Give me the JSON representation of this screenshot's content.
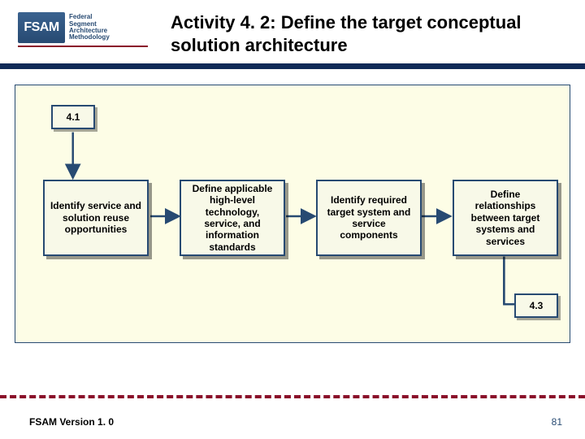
{
  "logo": {
    "mark": "FSAM",
    "line1": "Federal",
    "line2": "Segment",
    "line3": "Architecture",
    "line4": "Methodology"
  },
  "title": "Activity 4. 2:  Define the target conceptual solution architecture",
  "refs": {
    "in": "4.1",
    "out": "4.3"
  },
  "steps": [
    "Identify service and solution reuse opportunities",
    "Define applicable high-level technology, service, and information standards",
    "Identify required target system and service components",
    "Define relationships between target systems and services"
  ],
  "footer": {
    "version": "FSAM Version 1. 0",
    "page": "81"
  }
}
